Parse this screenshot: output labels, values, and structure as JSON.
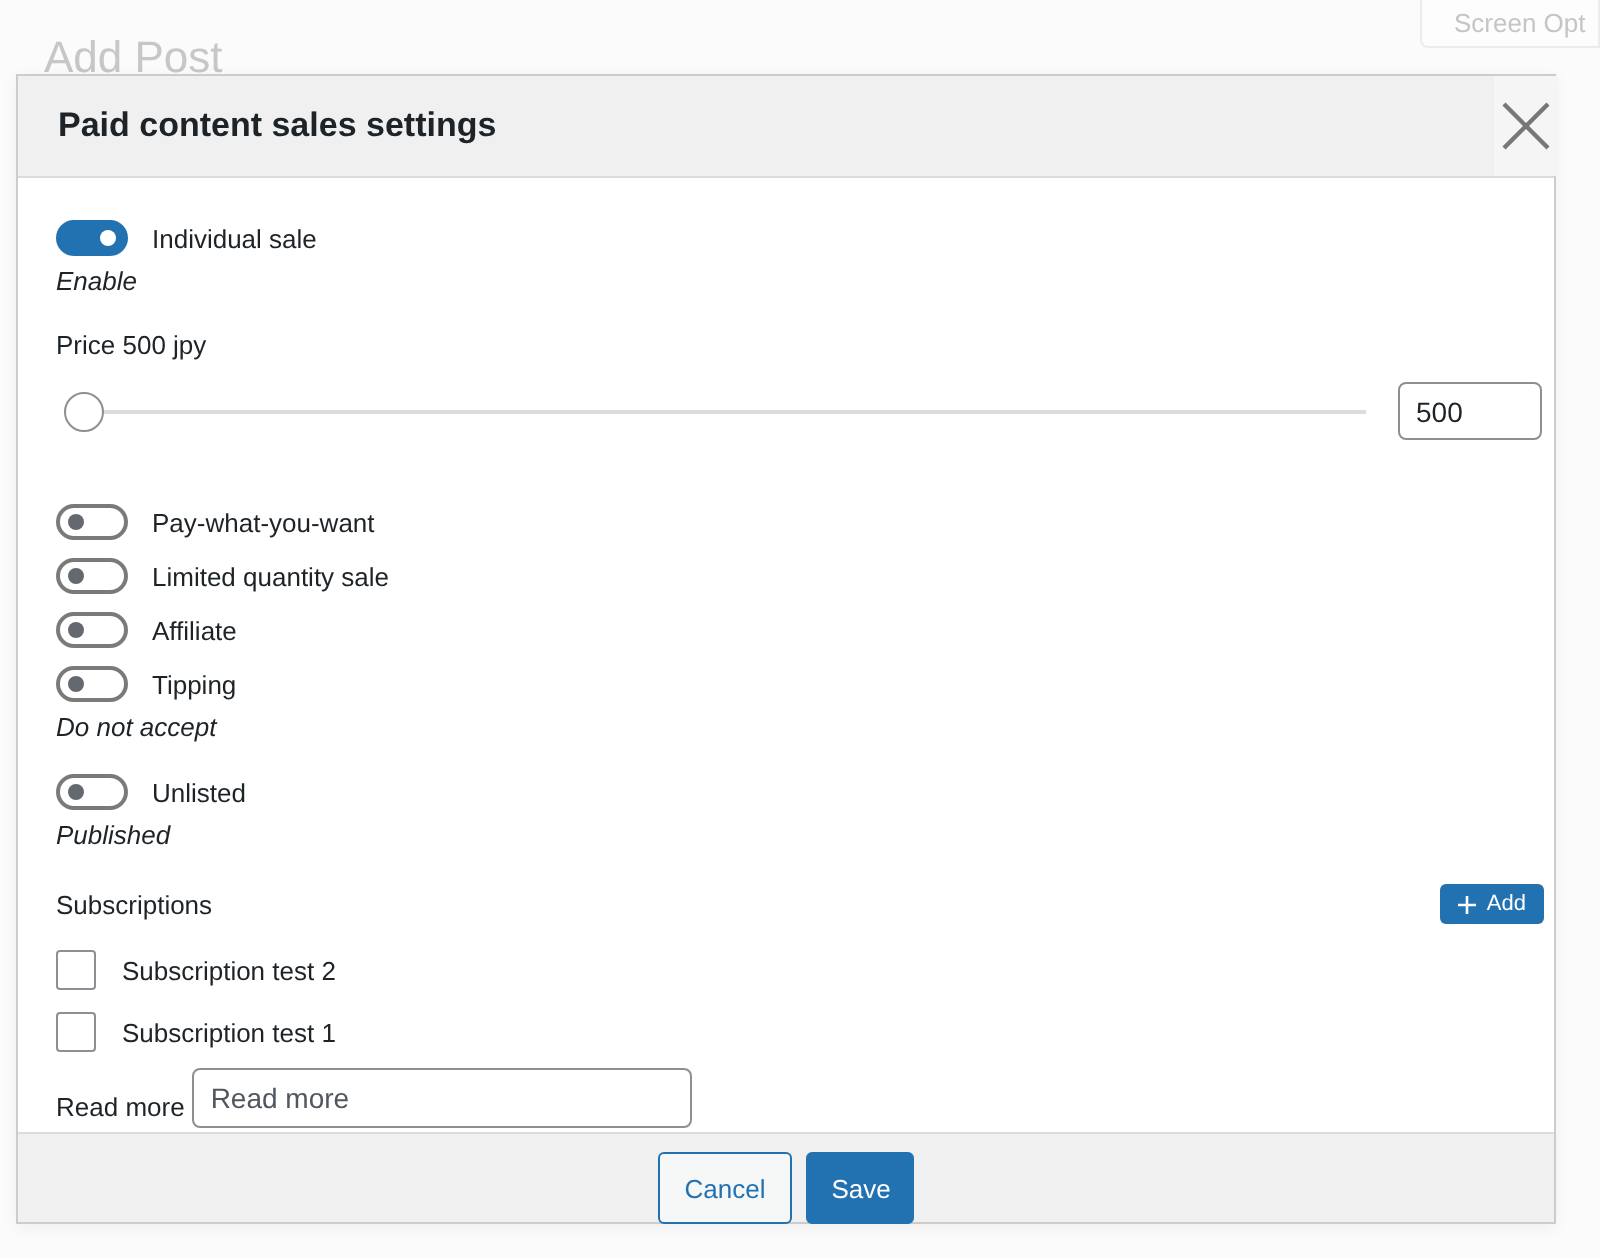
{
  "page": {
    "title": "Add Post",
    "screen_options": "Screen Opt"
  },
  "dialog": {
    "title": "Paid content sales settings",
    "rows": [
      {
        "kind": "toggle",
        "label": "Individual sale",
        "on": true
      },
      {
        "kind": "note",
        "text": "Enable"
      },
      {
        "kind": "price",
        "label": "Price 500 jpy",
        "level": 0,
        "value": "500"
      },
      {
        "kind": "toggle",
        "label": "Pay-what-you-want",
        "on": false
      },
      {
        "kind": "toggle",
        "label": "Limited quantity sale",
        "on": false
      },
      {
        "kind": "toggle",
        "label": "Affiliate",
        "on": false
      },
      {
        "kind": "toggle",
        "label": "Tipping",
        "on": false
      },
      {
        "kind": "note",
        "text": "Do not accept"
      },
      {
        "kind": "toggle",
        "label": "Unlisted",
        "on": false
      },
      {
        "kind": "note",
        "text": "Published"
      },
      {
        "kind": "section",
        "label": "Subscriptions",
        "button": "Add"
      },
      {
        "kind": "checkbox",
        "label": "Subscription test 2",
        "checked": false
      },
      {
        "kind": "checkbox",
        "label": "Subscription test 1",
        "checked": false
      },
      {
        "kind": "text_input",
        "label": "Read more",
        "placeholder": "Read more"
      }
    ],
    "buttons": [
      {
        "label": "Cancel",
        "kind": "secondary"
      },
      {
        "label": "Save",
        "kind": "primary"
      }
    ]
  }
}
